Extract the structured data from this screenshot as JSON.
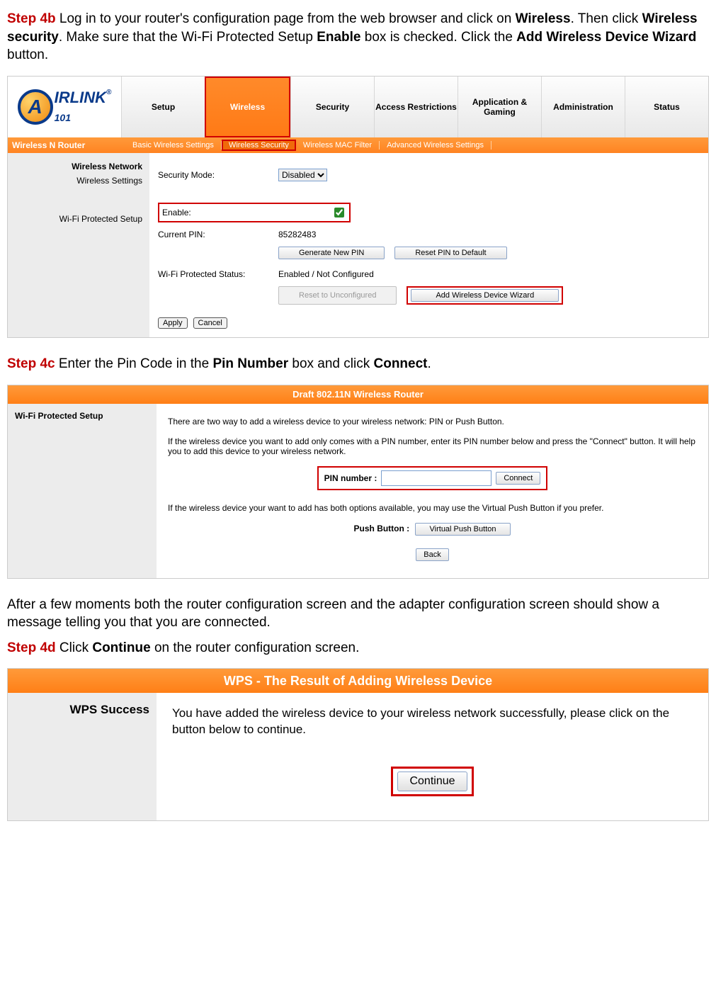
{
  "step4b": {
    "label": "Step 4b",
    "t1": " Log in to your router's configuration page from the web browser and click on ",
    "b1": "Wireless",
    "t2": ".  Then click ",
    "b2": "Wireless security",
    "t3": ".  Make sure that the Wi-Fi Protected Setup ",
    "b3": "Enable",
    "t4": " box is checked. Click the ",
    "b4": "Add Wireless Device Wizard",
    "t5": " button."
  },
  "shot1": {
    "logo_text": "IRLINK",
    "logo_sub": "101",
    "logo_reg": "®",
    "tabs": [
      "Setup",
      "Wireless",
      "Security",
      "Access Restrictions",
      "Application & Gaming",
      "Administration",
      "Status"
    ],
    "active_tab_index": 1,
    "model": "Wireless N Router",
    "subtabs": [
      "Basic Wireless Settings",
      "Wireless Security",
      "Wireless MAC Filter",
      "Advanced Wireless Settings"
    ],
    "active_subtab_index": 1,
    "side_group": "Wireless Network",
    "side_item1": "Wireless Settings",
    "side_item2": "Wi-Fi Protected Setup",
    "security_mode_label": "Security Mode:",
    "security_mode_value": "Disabled",
    "enable_label": "Enable:",
    "current_pin_label": "Current PIN:",
    "current_pin_value": "85282483",
    "btn_gen_pin": "Generate New PIN",
    "btn_reset_pin": "Reset PIN to Default",
    "wps_status_label": "Wi-Fi Protected Status:",
    "wps_status_value": "Enabled / Not Configured",
    "btn_reset_unconf": "Reset to Unconfigured",
    "btn_add_wizard": "Add Wireless Device Wizard",
    "btn_apply": "Apply",
    "btn_cancel": "Cancel"
  },
  "step4c": {
    "label": "Step 4c",
    "t1": " Enter the Pin Code in the ",
    "b1": "Pin Number",
    "t2": " box and click ",
    "b2": "Connect",
    "t3": "."
  },
  "shot2": {
    "header": "Draft 802.11N Wireless Router",
    "side_title": "Wi-Fi Protected Setup",
    "p1": "There are two way to add a wireless device to your wireless network: PIN or Push Button.",
    "p2": "If the wireless device you want to add only comes with a PIN number, enter its PIN number below and press the \"Connect\" button. It will help you to add this device to your wireless network.",
    "pin_label": "PIN number :",
    "btn_connect": "Connect",
    "p3": "If the wireless device your want to add has both options available, you may use the Virtual Push Button if you prefer.",
    "push_label": "Push Button :",
    "btn_vpb": "Virtual Push Button",
    "btn_back": "Back"
  },
  "after_text": "After a few moments both the router configuration screen and the adapter configuration screen should show a message telling you that you are connected.",
  "step4d": {
    "label": "Step 4d",
    "t1": " Click ",
    "b1": "Continue",
    "t2": " on the router configuration screen."
  },
  "shot3": {
    "header": "WPS - The Result of Adding Wireless Device",
    "side_title": "WPS Success",
    "msg": "You have added the wireless device to your wireless network successfully, please click on the button below to continue.",
    "btn_continue": "Continue"
  }
}
